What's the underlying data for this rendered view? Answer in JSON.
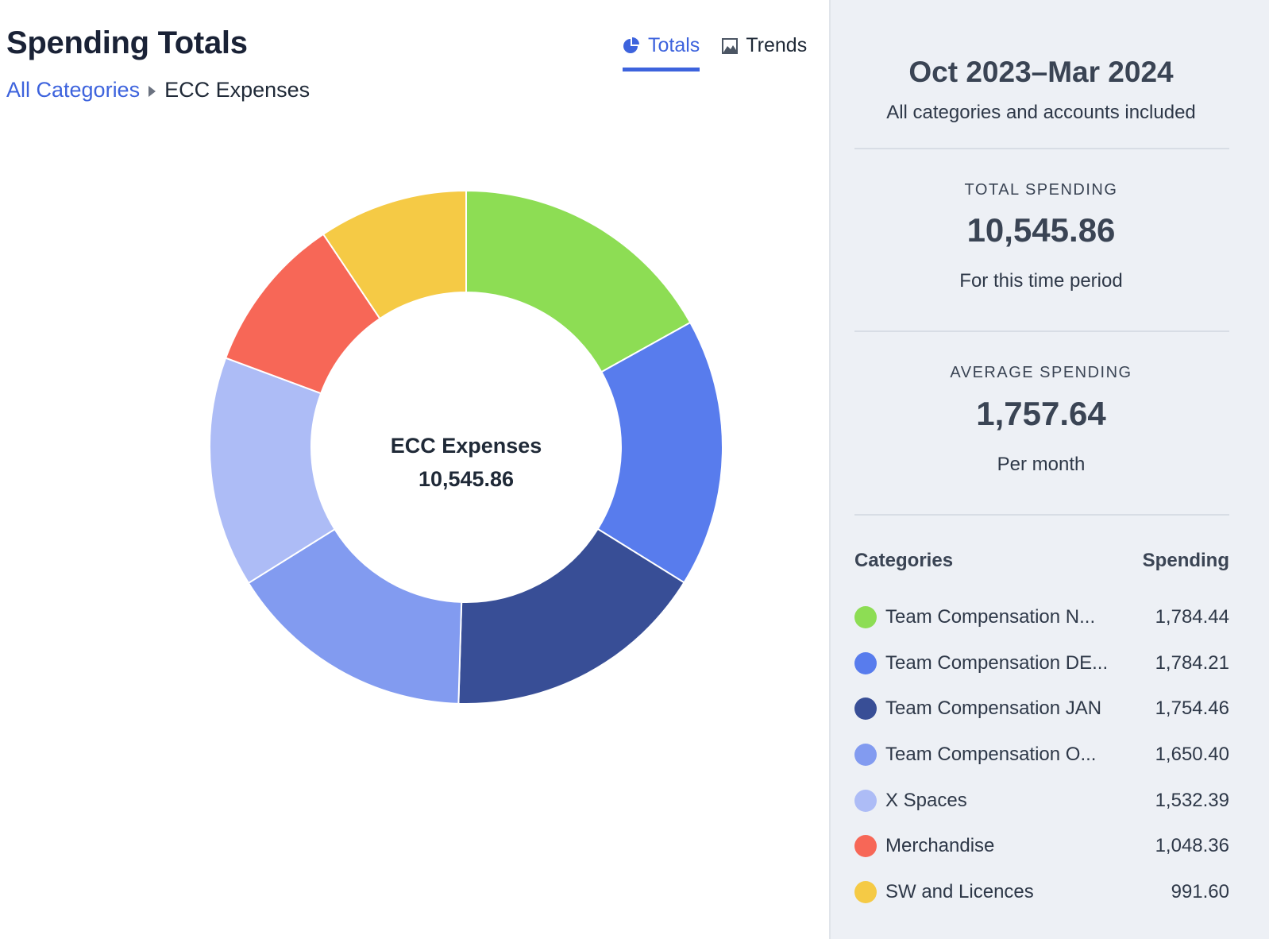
{
  "header": {
    "title": "Spending Totals",
    "breadcrumb": {
      "root": "All Categories",
      "current": "ECC Expenses"
    },
    "tabs": [
      {
        "label": "Totals",
        "icon": "pie-chart-icon",
        "active": true
      },
      {
        "label": "Trends",
        "icon": "image-chart-icon",
        "active": false
      }
    ]
  },
  "chart_data": {
    "type": "pie",
    "variant": "donut",
    "center_title": "ECC Expenses",
    "center_value": "10,545.86",
    "total": 10545.86,
    "slices": [
      {
        "label": "Team Compensation N...",
        "value": 1784.44,
        "color": "#8ddd54"
      },
      {
        "label": "Team Compensation DE...",
        "value": 1784.21,
        "color": "#587ced"
      },
      {
        "label": "Team Compensation JAN",
        "value": 1754.46,
        "color": "#384e96"
      },
      {
        "label": "Team Compensation O...",
        "value": 1650.4,
        "color": "#829bf0"
      },
      {
        "label": "X Spaces",
        "value": 1532.39,
        "color": "#adbcf6"
      },
      {
        "label": "Merchandise",
        "value": 1048.36,
        "color": "#f76757"
      },
      {
        "label": "SW and Licences",
        "value": 991.6,
        "color": "#f5ca45"
      }
    ]
  },
  "sidebar": {
    "period": "Oct 2023–Mar 2024",
    "period_sub": "All categories and accounts included",
    "total": {
      "label": "TOTAL SPENDING",
      "value": "10,545.86",
      "sub": "For this time period"
    },
    "average": {
      "label": "AVERAGE SPENDING",
      "value": "1,757.64",
      "sub": "Per month"
    },
    "categories_header": "Categories",
    "spending_header": "Spending",
    "categories": [
      {
        "name": "Team Compensation N...",
        "value": "1,784.44",
        "color": "#8ddd54"
      },
      {
        "name": "Team Compensation DE...",
        "value": "1,784.21",
        "color": "#587ced"
      },
      {
        "name": "Team Compensation JAN",
        "value": "1,754.46",
        "color": "#384e96"
      },
      {
        "name": "Team Compensation O...",
        "value": "1,650.40",
        "color": "#829bf0"
      },
      {
        "name": "X Spaces",
        "value": "1,532.39",
        "color": "#adbcf6"
      },
      {
        "name": "Merchandise",
        "value": "1,048.36",
        "color": "#f76757"
      },
      {
        "name": "SW and Licences",
        "value": "991.60",
        "color": "#f5ca45"
      }
    ]
  }
}
